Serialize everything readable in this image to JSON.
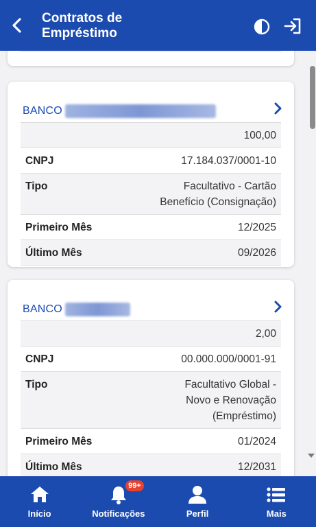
{
  "header": {
    "title_line1": "Contratos de",
    "title_line2": "Empréstimo",
    "back_icon": "chevron-left-icon",
    "contrast_icon": "contrast-icon",
    "logout_icon": "logout-icon",
    "color": "#1c4bb0"
  },
  "contracts": [
    {
      "bank_prefix": "BANCO",
      "bank_name_redacted": "MERCANTIL DO BRASIL SA",
      "value": "100,00",
      "cnpj_label": "CNPJ",
      "cnpj": "17.184.037/0001-10",
      "tipo_label": "Tipo",
      "tipo": "Facultativo - Cartão Benefício (Consignação)",
      "primeiro_label": "Primeiro Mês",
      "primeiro": "12/2025",
      "ultimo_label": "Último Mês",
      "ultimo": "09/2026"
    },
    {
      "bank_prefix": "BANCO",
      "bank_name_redacted": "DO BRASIL",
      "value": "2,00",
      "cnpj_label": "CNPJ",
      "cnpj": "00.000.000/0001-91",
      "tipo_label": "Tipo",
      "tipo": "Facultativo Global - Novo e Renovação (Empréstimo)",
      "primeiro_label": "Primeiro Mês",
      "primeiro": "01/2024",
      "ultimo_label": "Último Mês",
      "ultimo": "12/2031"
    }
  ],
  "nav": {
    "inicio": "Início",
    "notificacoes": "Notificações",
    "notificacoes_badge": "99+",
    "perfil": "Perfil",
    "mais": "Mais"
  },
  "colors": {
    "accent": "#1c4bb0",
    "badge": "#e8412f"
  }
}
